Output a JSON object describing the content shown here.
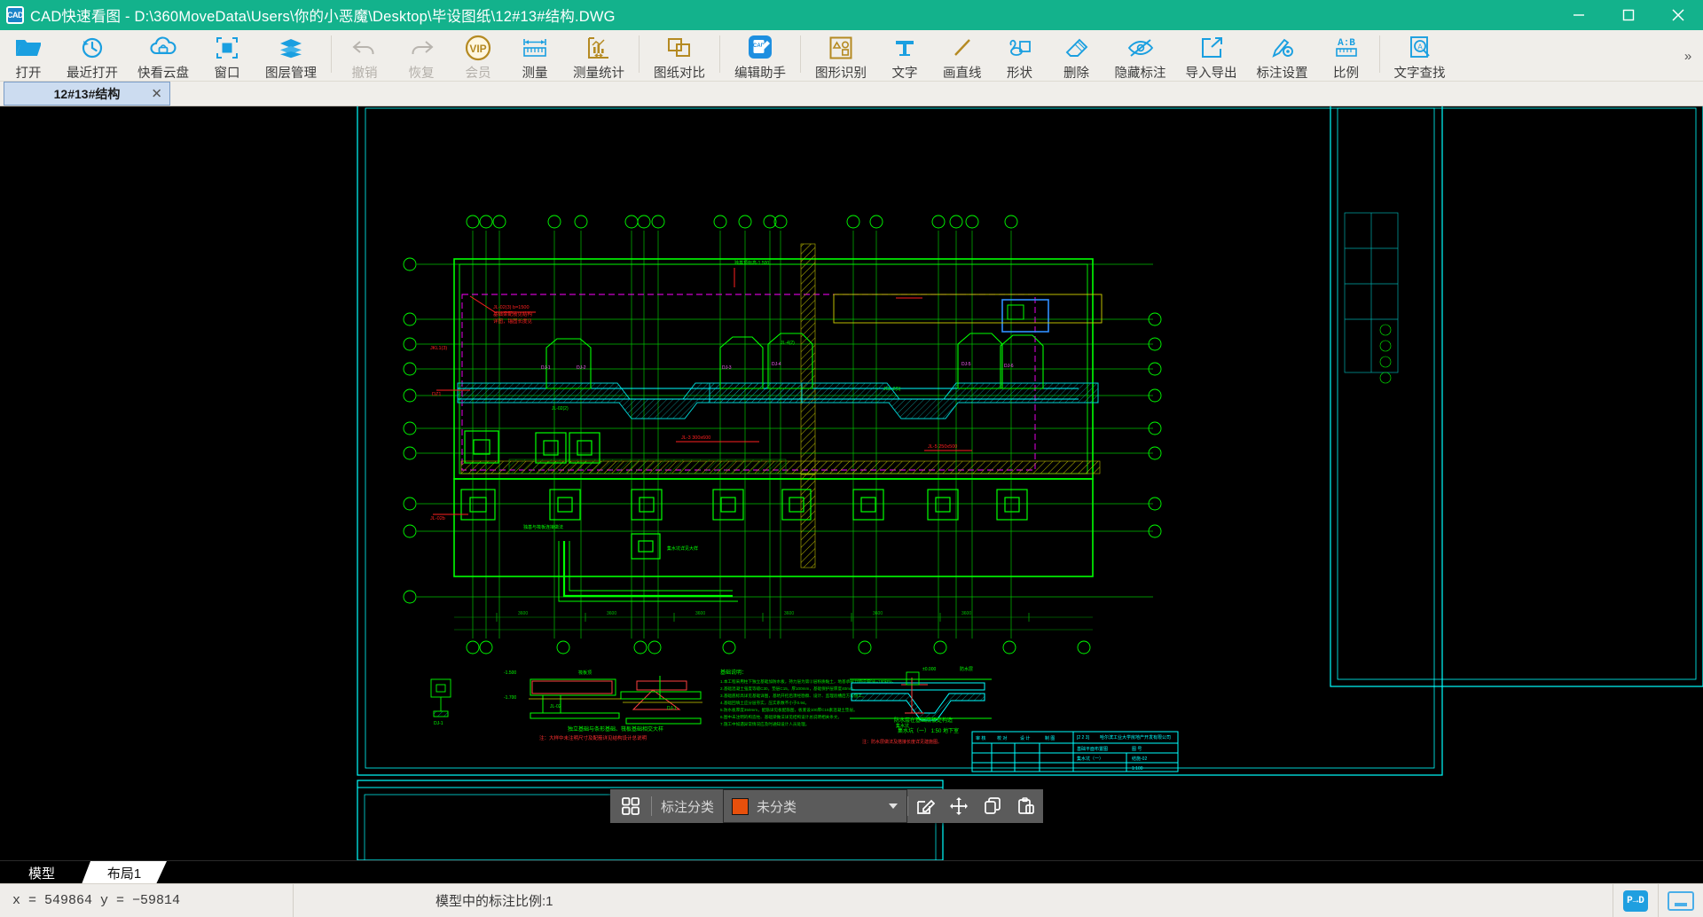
{
  "titlebar": {
    "logo_text": "CAD",
    "title": "CAD快速看图 - D:\\360MoveData\\Users\\你的小恶魔\\Desktop\\毕设图纸\\12#13#结构.DWG",
    "minimize_name": "minimize",
    "maximize_name": "maximize",
    "close_name": "close"
  },
  "ribbon": {
    "items": [
      {
        "label": "打开",
        "icon": "folder-open-icon",
        "dim": false
      },
      {
        "label": "最近打开",
        "icon": "recent-clock-icon",
        "dim": false
      },
      {
        "label": "快看云盘",
        "icon": "cloud-icon",
        "dim": false
      },
      {
        "label": "窗口",
        "icon": "window-frame-icon",
        "dim": false
      },
      {
        "label": "图层管理",
        "icon": "layers-icon",
        "dim": false
      },
      {
        "sep": true
      },
      {
        "label": "撤销",
        "icon": "undo-arrow-icon",
        "dim": true
      },
      {
        "label": "恢复",
        "icon": "redo-arrow-icon",
        "dim": true
      },
      {
        "label": "会员",
        "icon": "vip-badge-icon",
        "dim": true
      },
      {
        "label": "测量",
        "icon": "ruler-measure-icon",
        "dim": false
      },
      {
        "label": "测量统计",
        "icon": "measure-stats-icon",
        "dim": false
      },
      {
        "sep": true
      },
      {
        "label": "图纸对比",
        "icon": "compare-drawings-icon",
        "dim": false
      },
      {
        "sep": true
      },
      {
        "label": "编辑助手",
        "icon": "cad-edit-assistant-icon",
        "dim": false
      },
      {
        "sep": true
      },
      {
        "label": "图形识别",
        "icon": "shape-recognize-icon",
        "dim": false
      },
      {
        "label": "文字",
        "icon": "text-tool-icon",
        "dim": false
      },
      {
        "label": "画直线",
        "icon": "draw-line-icon",
        "dim": false
      },
      {
        "label": "形状",
        "icon": "shapes-icon",
        "dim": false
      },
      {
        "label": "删除",
        "icon": "eraser-icon",
        "dim": false
      },
      {
        "label": "隐藏标注",
        "icon": "hide-annotation-icon",
        "dim": false
      },
      {
        "label": "导入导出",
        "icon": "import-export-icon",
        "dim": false
      },
      {
        "label": "标注设置",
        "icon": "annotation-settings-icon",
        "dim": false
      },
      {
        "label": "比例",
        "icon": "scale-ratio-icon",
        "dim": false
      },
      {
        "sep": true
      },
      {
        "label": "文字查找",
        "icon": "text-search-icon",
        "dim": false
      }
    ],
    "overflow_label": "»"
  },
  "doc_tabs": {
    "active": {
      "label": "12#13#结构",
      "close_glyph": "✕"
    }
  },
  "float_toolbar": {
    "grid_icon": "grid-apps-icon",
    "label": "标注分类",
    "selected_value": "未分类",
    "swatch_color": "#e8500c",
    "caret_glyph": "▼",
    "buttons": [
      {
        "name": "edit-annotation-button",
        "icon": "pencil-square-icon"
      },
      {
        "name": "move-annotation-button",
        "icon": "move-cross-icon"
      },
      {
        "name": "copy-annotation-button",
        "icon": "copy-icon"
      },
      {
        "name": "paste-annotation-button",
        "icon": "paste-icon"
      }
    ]
  },
  "layout_tabs": {
    "model": "模型",
    "layout1": "布局1"
  },
  "statusbar": {
    "coords": "x = 549864  y = −59814",
    "scale_text": "模型中的标注比例:1",
    "pdf_badge": "P→D",
    "minimize_icon": "minimize-panel-icon"
  },
  "drawing": {
    "title_block": {
      "project": "哈尔滨工业大学房地产开发有限公司",
      "drawing_name": "基础平面布置图",
      "sheet": "结施-02",
      "scale": "1:100"
    },
    "notes_heading": "基础说明：",
    "detail_captions": [
      "独立基础与条形基础、筏板基础相交大样",
      "防水层在基础底板处构造",
      "集水坑（一）"
    ],
    "canvas_bg": "#000000",
    "colors": {
      "green": "#00ff00",
      "cyan": "#00ffff",
      "red": "#ff0000",
      "magenta": "#ff00ff",
      "yellow": "#ffff00",
      "white": "#ffffff",
      "blue": "#0080ff"
    }
  }
}
